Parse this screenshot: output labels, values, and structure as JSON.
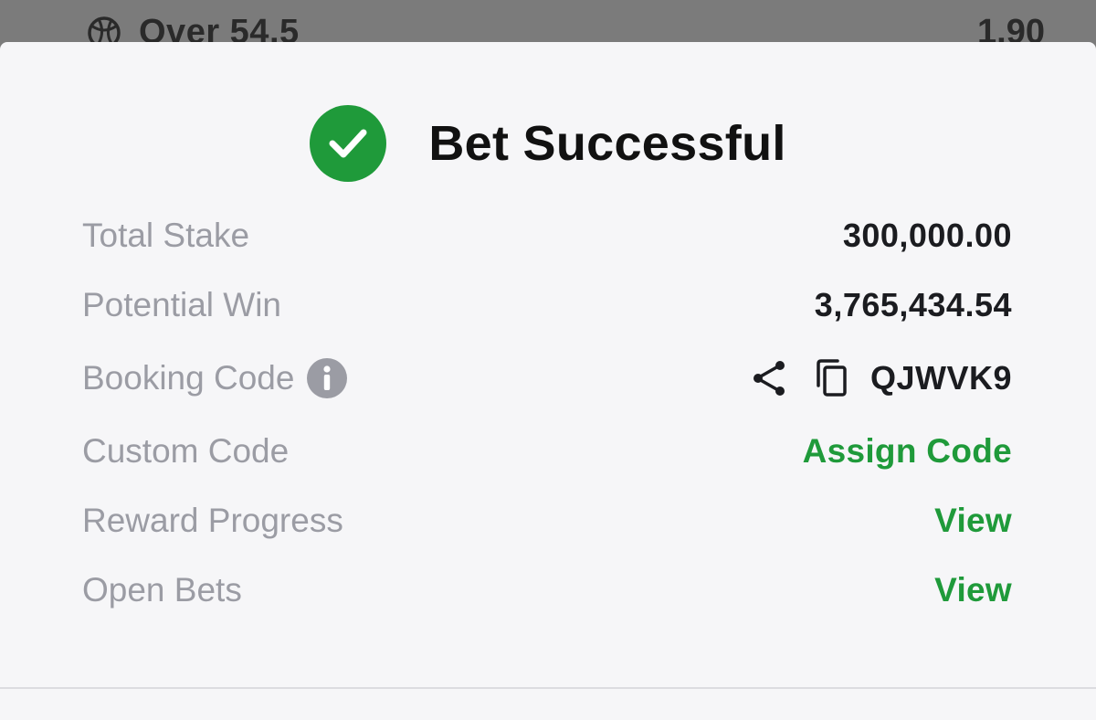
{
  "backdrop": {
    "selection_label": "Over 54.5",
    "selection_odds": "1.90",
    "selection_icon": "basketball-icon"
  },
  "modal": {
    "title": "Bet Successful",
    "status_icon": "check-circle-icon",
    "accent_color": "#1f9a3a",
    "rows": {
      "total_stake": {
        "label": "Total Stake",
        "value": "300,000.00"
      },
      "potential_win": {
        "label": "Potential Win",
        "value": "3,765,434.54"
      },
      "booking_code": {
        "label": "Booking Code",
        "value": "QJWVK9",
        "icons": [
          "info-icon",
          "share-icon",
          "copy-icon"
        ]
      },
      "custom_code": {
        "label": "Custom Code",
        "action": "Assign Code"
      },
      "reward_progress": {
        "label": "Reward Progress",
        "action": "View"
      },
      "open_bets": {
        "label": "Open Bets",
        "action": "View"
      }
    }
  }
}
